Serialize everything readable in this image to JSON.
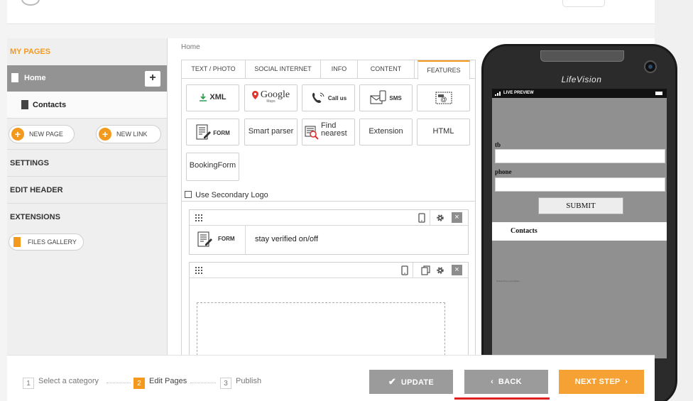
{
  "sidebar": {
    "my_pages": "MY PAGES",
    "pages": [
      "Home",
      "Contacts"
    ],
    "add_symbol": "+",
    "new_page": "NEW PAGE",
    "new_link": "NEW LINK",
    "settings": "SETTINGS",
    "edit_header": "EDIT HEADER",
    "extensions": "EXTENSIONS",
    "files_gallery": "FILES GALLERY"
  },
  "breadcrumb": "Home",
  "tabs": [
    "TEXT / PHOTO",
    "SOCIAL INTERNET",
    "INFO",
    "CONTENT",
    "FEATURES"
  ],
  "features": {
    "xml": "XML",
    "google": "Google",
    "google_sub": "Maps",
    "call_us": "Call us",
    "sms": "SMS",
    "form": "FORM",
    "smart_parser": "Smart parser",
    "find_nearest": "Find nearest",
    "extension": "Extension",
    "html": "HTML",
    "booking_form": "BookingForm"
  },
  "secondary_logo": "Use Secondary Logo",
  "blocks": {
    "form_label": "FORM",
    "form_text": "stay verified on/off",
    "close": "×"
  },
  "phone": {
    "brand": "LifeVision",
    "status": "LIVE PREVIEW",
    "field1_label": "tb",
    "field2_label": "phone",
    "submit": "SUBMIT",
    "nav_item": "Contacts",
    "powered": "Powered by mycompany"
  },
  "footer": {
    "steps": [
      {
        "num": "1",
        "label": "Select a category"
      },
      {
        "num": "2",
        "label": "Edit Pages"
      },
      {
        "num": "3",
        "label": "Publish"
      }
    ],
    "update": "UPDATE",
    "back": "BACK",
    "next": "NEXT STEP"
  },
  "colors": {
    "accent": "#f39a1e",
    "gray_button": "#9b9b9b",
    "underline": "#e02020"
  }
}
